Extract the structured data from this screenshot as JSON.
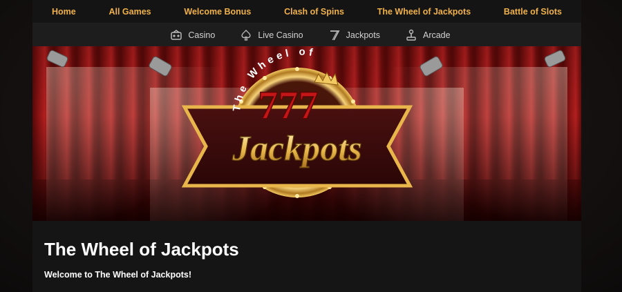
{
  "top_nav": {
    "items": [
      "Home",
      "All Games",
      "Welcome Bonus",
      "Clash of Spins",
      "The Wheel of Jackpots",
      "Battle of Slots"
    ]
  },
  "sub_nav": {
    "items": [
      {
        "label": "Casino",
        "icon": "casino-icon"
      },
      {
        "label": "Live Casino",
        "icon": "spade-icon"
      },
      {
        "label": "Jackpots",
        "icon": "seven-icon"
      },
      {
        "label": "Arcade",
        "icon": "joystick-icon"
      }
    ]
  },
  "banner": {
    "arc_text": "The Wheel of",
    "ribbon_text": "Jackpots",
    "numerals": "777"
  },
  "content": {
    "title": "The Wheel of Jackpots",
    "lead": "Welcome to The Wheel of Jackpots!"
  },
  "colors": {
    "nav_accent": "#f0b14a",
    "curtain": "#b31f1f",
    "gold": "#e8b64a"
  }
}
